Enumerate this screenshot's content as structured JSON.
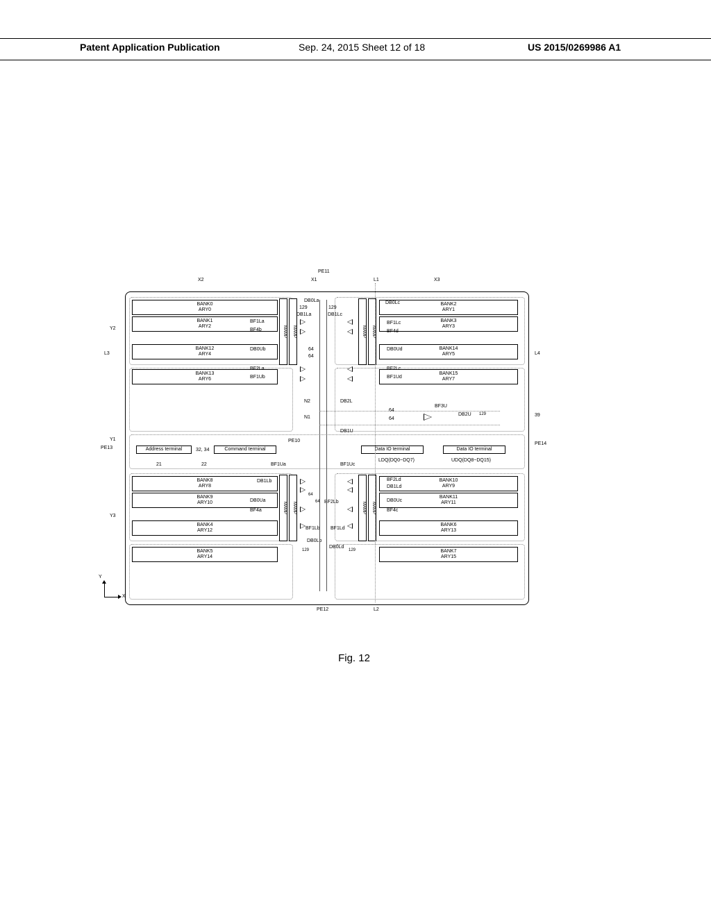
{
  "header": {
    "left": "Patent Application Publication",
    "center": "Sep. 24, 2015  Sheet 12 of 18",
    "right": "US 2015/0269986 A1"
  },
  "figure_label": "Fig. 12",
  "axes": {
    "y": "Y",
    "x": "X"
  },
  "outer": {
    "cols": {
      "x2": "X2",
      "x1": "X1",
      "x3": "X3"
    },
    "lines": {
      "l1": "L1",
      "l2": "L2",
      "l3": "L3",
      "l4": "L4"
    },
    "rows": {
      "y1": "Y1",
      "y2": "Y2",
      "y3": "Y3"
    },
    "pe": {
      "pe10": "PE10",
      "pe11": "PE11",
      "pe12": "PE12",
      "pe13": "PE13",
      "pe14": "PE14"
    }
  },
  "banks": {
    "tl": [
      {
        "bank": "BANK0",
        "ary": "ARY0"
      },
      {
        "bank": "BANK1",
        "ary": "ARY2"
      },
      {
        "bank": "BANK12",
        "ary": "ARY4"
      },
      {
        "bank": "BANK13",
        "ary": "ARY6"
      }
    ],
    "tr": [
      {
        "bank": "BANK2",
        "ary": "ARY1"
      },
      {
        "bank": "BANK3",
        "ary": "ARY3"
      },
      {
        "bank": "BANK14",
        "ary": "ARY5"
      },
      {
        "bank": "BANK15",
        "ary": "ARY7"
      }
    ],
    "bl": [
      {
        "bank": "BANK8",
        "ary": "ARY8"
      },
      {
        "bank": "BANK9",
        "ary": "ARY10"
      },
      {
        "bank": "BANK4",
        "ary": "ARY12"
      },
      {
        "bank": "BANK5",
        "ary": "ARY14"
      }
    ],
    "br": [
      {
        "bank": "BANK10",
        "ary": "ARY9"
      },
      {
        "bank": "BANK11",
        "ary": "ARY11"
      },
      {
        "bank": "BANK6",
        "ary": "ARY13"
      },
      {
        "bank": "BANK7",
        "ary": "ARY15"
      }
    ]
  },
  "mamp": "MAMP",
  "terminals": {
    "addr": "Address terminal",
    "cmd": "Command terminal",
    "data1": "Data IO terminal",
    "data2": "Data IO terminal"
  },
  "refs": {
    "r21": "21",
    "r22": "22",
    "r32_34": "32, 34",
    "r39": "39"
  },
  "dq": {
    "ldq": "LDQ(DQ0~DQ7)",
    "udq": "UDQ(DQ8~DQ15)"
  },
  "buswidth": {
    "n129": "129",
    "n64": "64"
  },
  "center_nodes": {
    "n1": "N1",
    "n2": "N2"
  },
  "buses": {
    "db0la": "DB0La",
    "db1la": "DB1La",
    "db0lb": "DB0Lb",
    "db1lb": "DB1Lb",
    "db0lc": "DB0Lc",
    "db1lc": "DB1Lc",
    "db0ld": "DB0Ld",
    "db1ld": "DB1Ld",
    "db0ua": "DB0Ua",
    "db0ub": "DB0Ub",
    "db0uc": "DB0Uc",
    "db0ud": "DB0Ud",
    "db1u": "DB1U",
    "db2l": "DB2L",
    "db2u": "DB2U"
  },
  "buffers": {
    "bf1la": "BF1La",
    "bf1lb": "BF1Lb",
    "bf1lc": "BF1Lc",
    "bf1ld": "BF1Ld",
    "bf2la": "BF2La",
    "bf2lb": "BF2Lb",
    "bf2lc": "BF2Lc",
    "bf2ld": "BF2Ld",
    "bf1ua": "BF1Ua",
    "bf1ub": "BF1Ub",
    "bf1uc": "BF1Uc",
    "bf1ud": "BF1Ud",
    "bf4a": "BF4a",
    "bf4b": "BF4b",
    "bf4c": "BF4c",
    "bf4d": "BF4d",
    "bf3u": "BF3U"
  }
}
